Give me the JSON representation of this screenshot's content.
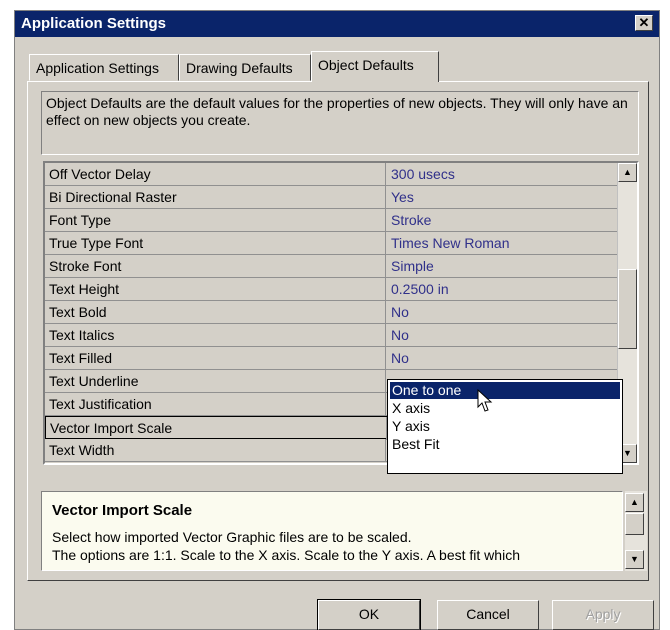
{
  "window": {
    "title": "Application Settings",
    "close_label": "✕"
  },
  "tabs": [
    {
      "label": "Application Settings",
      "active": false
    },
    {
      "label": "Drawing Defaults",
      "active": false
    },
    {
      "label": "Object Defaults",
      "active": true
    }
  ],
  "description": "Object Defaults are the default values for the properties of new objects. They will only have an effect on new objects you create.",
  "properties": [
    {
      "name": "Off Vector Delay",
      "value": "300 usecs"
    },
    {
      "name": "Bi Directional Raster",
      "value": "Yes"
    },
    {
      "name": "Font Type",
      "value": "Stroke"
    },
    {
      "name": "True Type Font",
      "value": "Times New Roman"
    },
    {
      "name": "Stroke Font",
      "value": "Simple"
    },
    {
      "name": "Text Height",
      "value": "0.2500 in"
    },
    {
      "name": "Text Bold",
      "value": "No"
    },
    {
      "name": "Text Italics",
      "value": "No"
    },
    {
      "name": "Text Filled",
      "value": "No"
    },
    {
      "name": "Text Underline",
      "value": ""
    },
    {
      "name": "Text Justification",
      "value": ""
    },
    {
      "name": "Vector Import Scale",
      "value": ""
    },
    {
      "name": "Text Width",
      "value": ""
    }
  ],
  "dropdown": {
    "options": [
      "One to one",
      "X axis",
      "Y axis",
      "Best Fit"
    ],
    "selected": "One to one"
  },
  "help": {
    "title": "Vector Import Scale",
    "line1": "Select how imported Vector Graphic files are to be scaled.",
    "line2": "The options are 1:1. Scale to the X axis. Scale to the Y axis. A best fit which"
  },
  "buttons": {
    "ok": "OK",
    "cancel": "Cancel",
    "apply": "Apply"
  },
  "colors": {
    "titlebar": "#0a246a",
    "selection": "#0a246a",
    "value_text": "#30308a"
  },
  "icons": {
    "scroll_up": "up-arrow-icon",
    "scroll_down": "down-arrow-icon",
    "cursor": "mouse-pointer-icon"
  }
}
